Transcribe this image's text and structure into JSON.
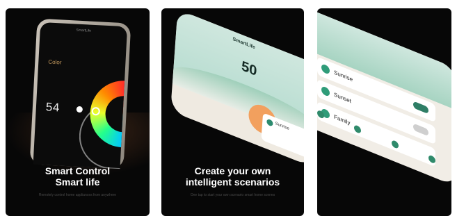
{
  "cards": [
    {
      "app_title": "SmartLife",
      "mode_label": "Color",
      "brightness_value": "54",
      "headline_line1": "Smart Control",
      "headline_line2": "Smart life",
      "subtitle": "Remotely control home appliances from anywhere"
    },
    {
      "app_name": "SmartLife",
      "temperature": "50",
      "headline_line1": "Create your own",
      "headline_line2": "intelligent scenarios",
      "subtitle": "One tap to start your own scenario smart home scenes"
    },
    {
      "row1_label": "Sunrise",
      "row2_label": "Sunset",
      "row3_label": "Family"
    }
  ],
  "colors": {
    "card_bg": "#070707",
    "accent_teal": "#2f8a6b",
    "accent_orange": "#c59a5e"
  }
}
